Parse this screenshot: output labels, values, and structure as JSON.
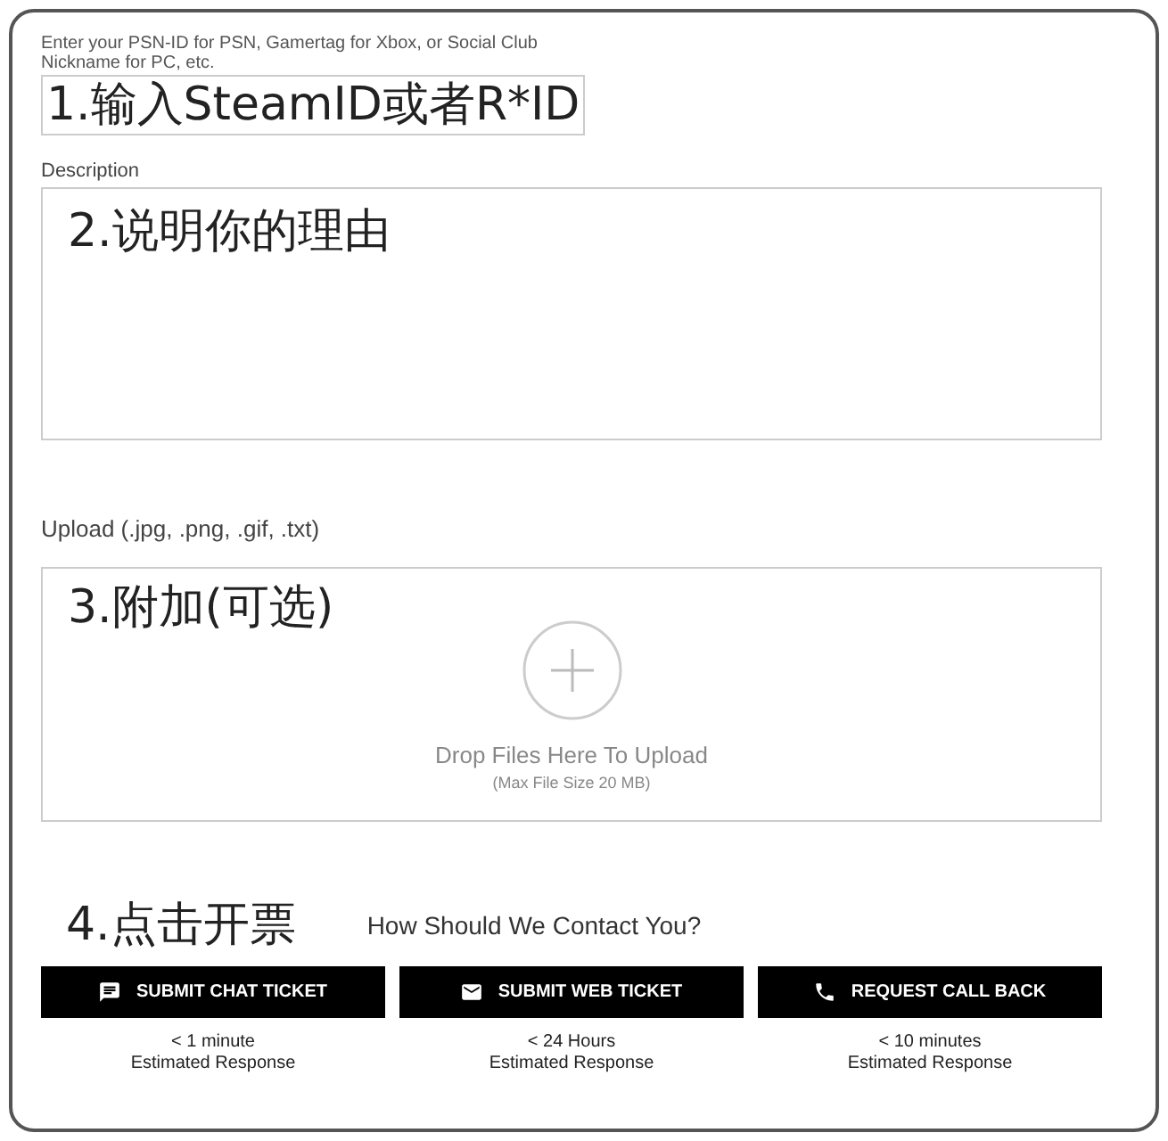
{
  "id_field": {
    "hint": "Enter your PSN-ID for PSN, Gamertag for Xbox, or Social Club Nickname for PC, etc.",
    "value": "1.输入SteamID或者R*ID"
  },
  "description": {
    "label": "Description",
    "value": "2.说明你的理由"
  },
  "upload": {
    "label": "Upload (.jpg, .png, .gif, .txt)",
    "annotation": "3.附加(可选)",
    "drop_text": "Drop Files Here To Upload",
    "size_note": "(Max File Size 20 MB)"
  },
  "contact": {
    "annotation": "4.点击开票",
    "heading": "How Should We Contact You?",
    "options": [
      {
        "kind": "chat",
        "label": "SUBMIT CHAT TICKET",
        "time": "< 1 minute",
        "note": "Estimated Response"
      },
      {
        "kind": "web",
        "label": "SUBMIT WEB TICKET",
        "time": "< 24 Hours",
        "note": "Estimated Response"
      },
      {
        "kind": "call",
        "label": "REQUEST CALL BACK",
        "time": "< 10 minutes",
        "note": "Estimated Response"
      }
    ]
  }
}
